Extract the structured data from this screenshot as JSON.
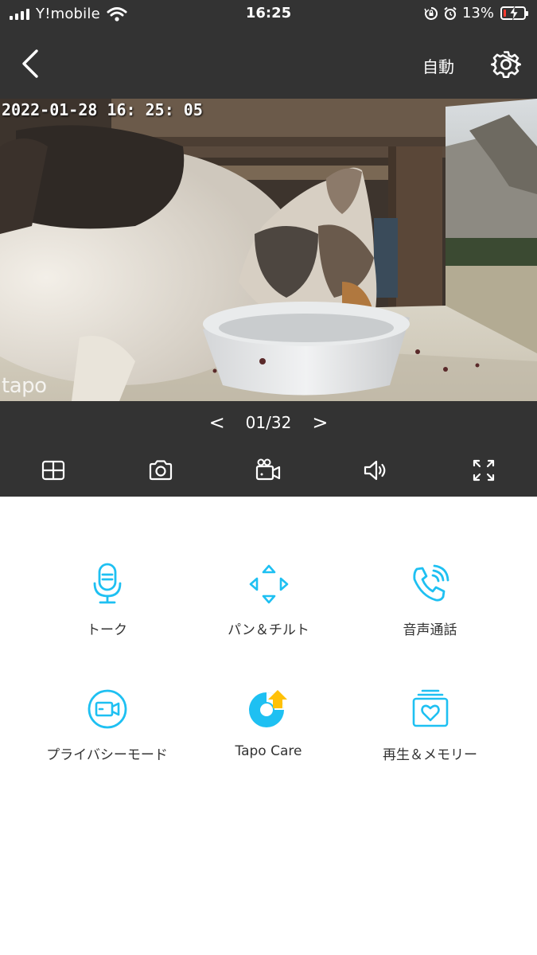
{
  "status_bar": {
    "carrier": "Y!mobile",
    "time": "16:25",
    "battery_percent": "13%",
    "battery_level": 0.13
  },
  "nav": {
    "back_icon": "chevron-left-icon",
    "mode_label": "自動",
    "settings_icon": "gear-icon"
  },
  "video": {
    "timestamp": "2022-01-28  16: 25: 05",
    "watermark": "tapo"
  },
  "pager": {
    "prev": "<",
    "count": "01/32",
    "next": ">"
  },
  "toolbar": {
    "items": [
      "grid-icon",
      "camera-icon",
      "video-record-icon",
      "speaker-icon",
      "fullscreen-icon"
    ]
  },
  "features": [
    {
      "label": "トーク",
      "icon": "microphone-icon"
    },
    {
      "label": "パン＆チルト",
      "icon": "pan-tilt-icon"
    },
    {
      "label": "音声通話",
      "icon": "phone-call-icon"
    },
    {
      "label": "プライバシーモード",
      "icon": "privacy-mode-icon"
    },
    {
      "label": "Tapo Care",
      "icon": "tapo-care-icon"
    },
    {
      "label": "再生＆メモリー",
      "icon": "playback-memory-icon"
    }
  ],
  "colors": {
    "dark_bg": "#333333",
    "accent": "#1ec0f2",
    "care_accent": "#ffc107",
    "battery_low": "#ff3b30"
  }
}
